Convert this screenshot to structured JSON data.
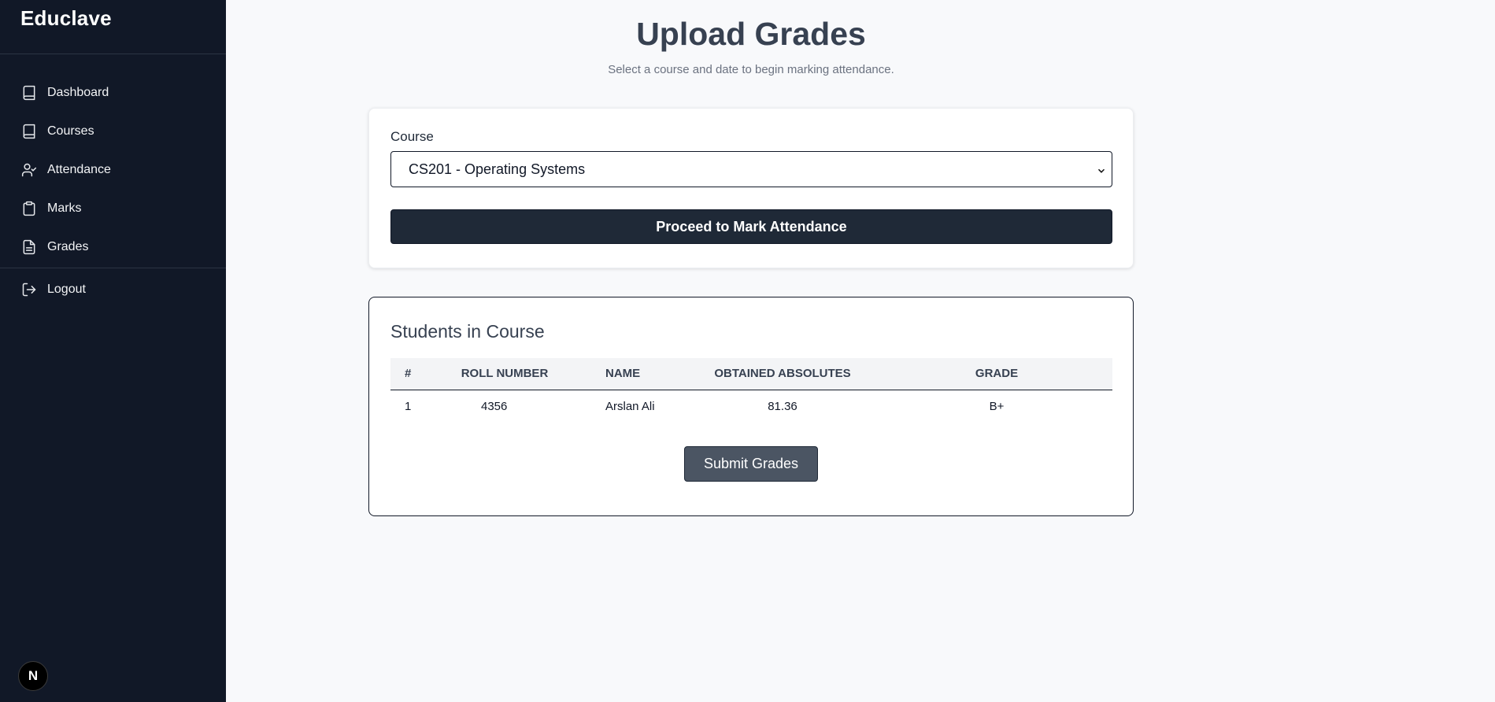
{
  "app": {
    "brand": "Educlave"
  },
  "sidebar": {
    "items": [
      {
        "label": "Dashboard",
        "icon": "book-icon"
      },
      {
        "label": "Courses",
        "icon": "book-icon"
      },
      {
        "label": "Attendance",
        "icon": "user-check-icon"
      },
      {
        "label": "Marks",
        "icon": "clipboard-icon"
      },
      {
        "label": "Grades",
        "icon": "file-text-icon"
      }
    ],
    "logout": {
      "label": "Logout",
      "icon": "logout-icon"
    },
    "badge": "N"
  },
  "page": {
    "title": "Upload Grades",
    "subtitle": "Select a course and date to begin marking attendance."
  },
  "course_form": {
    "label": "Course",
    "selected": "CS201 - Operating Systems",
    "proceed_label": "Proceed to Mark Attendance"
  },
  "students": {
    "title": "Students in Course",
    "columns": [
      "#",
      "ROLL NUMBER",
      "NAME",
      "OBTAINED ABSOLUTES",
      "GRADE"
    ],
    "rows": [
      {
        "idx": "1",
        "roll": "4356",
        "name": "Arslan Ali",
        "absolutes": "81.36",
        "grade": "B+"
      }
    ],
    "submit_label": "Submit Grades"
  },
  "colors": {
    "sidebar_bg": "#111827",
    "primary_button": "#1f2937",
    "submit_button": "#4b5563",
    "page_bg": "#f8f9fb"
  }
}
